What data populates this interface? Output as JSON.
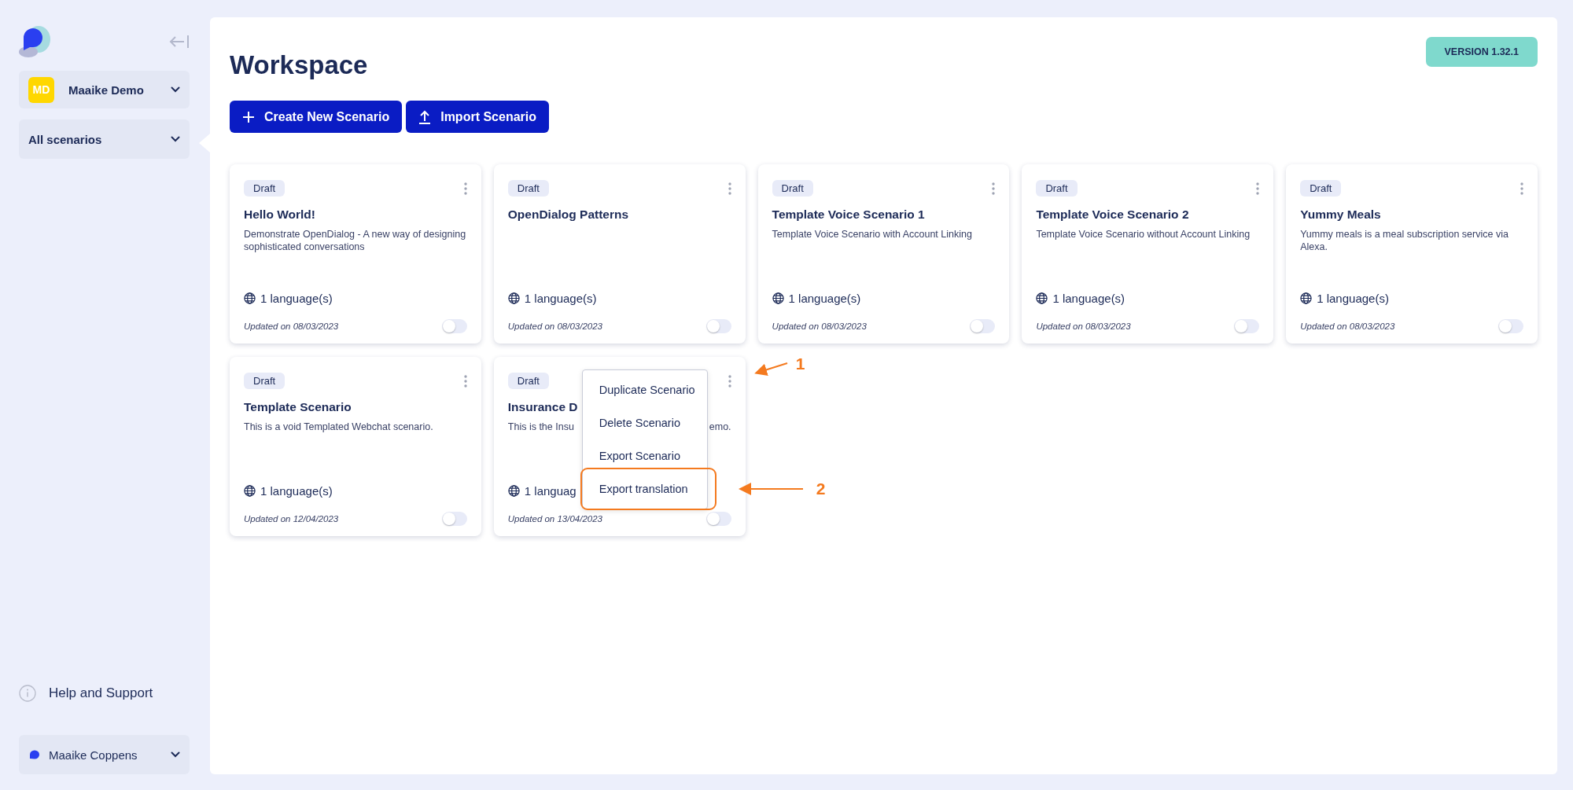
{
  "sidebar": {
    "organization": {
      "initials": "MD",
      "name": "Maaike Demo"
    },
    "filter": "All scenarios",
    "help": "Help and Support",
    "user": "Maaike Coppens"
  },
  "page": {
    "title": "Workspace",
    "version": "VERSION 1.32.1",
    "buttons": [
      {
        "label": "Create New Scenario",
        "kind": "create"
      },
      {
        "label": "Import Scenario",
        "kind": "import"
      }
    ]
  },
  "scenarios": [
    {
      "status": "Draft",
      "title": "Hello World!",
      "description": "Demonstrate OpenDialog - A new way of designing sophisticated conversations",
      "languages": "1 language(s)",
      "updated": "Updated on 08/03/2023",
      "on": false
    },
    {
      "status": "Draft",
      "title": "OpenDialog Patterns",
      "languages": "1 language(s)",
      "updated": "Updated on 08/03/2023",
      "on": false
    },
    {
      "status": "Draft",
      "title": "Template Voice Scenario 1",
      "description": "Template Voice Scenario with Account Linking",
      "languages": "1 language(s)",
      "updated": "Updated on 08/03/2023",
      "on": false
    },
    {
      "status": "Draft",
      "title": "Template Voice Scenario 2",
      "description": "Template Voice Scenario without Account Linking",
      "languages": "1 language(s)",
      "updated": "Updated on 08/03/2023",
      "on": false
    },
    {
      "status": "Draft",
      "title": "Yummy Meals",
      "description": "Yummy meals is a meal subscription service via Alexa.",
      "languages": "1 language(s)",
      "updated": "Updated on 08/03/2023",
      "on": false
    },
    {
      "status": "Draft",
      "title": "Template Scenario",
      "description": "This is a void Templated Webchat scenario.",
      "languages": "1 language(s)",
      "updated": "Updated on 12/04/2023",
      "on": false
    },
    {
      "status": "Draft",
      "title": "Insurance D",
      "description": "This is the Insu",
      "description_end": "emo.",
      "languages": "1 languag",
      "updated": "Updated on 13/04/2023",
      "on": false,
      "menu": [
        {
          "label": "Duplicate Scenario",
          "highlighted": false
        },
        {
          "label": "Delete Scenario",
          "highlighted": false
        },
        {
          "label": "Export Scenario",
          "highlighted": false
        },
        {
          "label": "Export translation",
          "highlighted": true
        }
      ]
    }
  ],
  "annotations": [
    {
      "label": "1",
      "kind": "button"
    },
    {
      "label": "2",
      "kind": "item"
    }
  ]
}
